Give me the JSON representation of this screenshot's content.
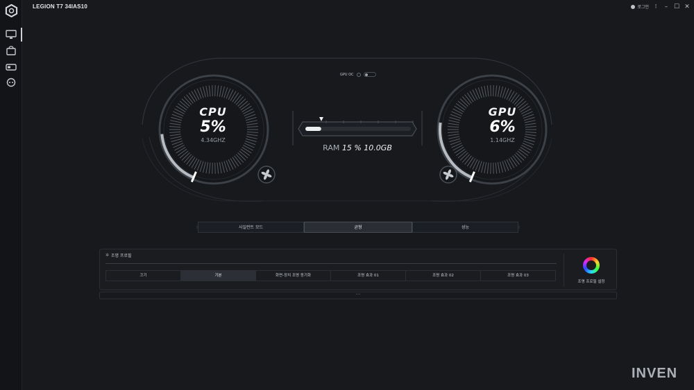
{
  "app": {
    "title": "LEGION T7 34IAS10"
  },
  "titlebar": {
    "login_label": "로그인"
  },
  "sidebar": {
    "items": [
      {
        "icon": "monitor-icon",
        "active": true
      },
      {
        "icon": "shop-bag-icon",
        "active": false
      },
      {
        "icon": "device-toggle-icon",
        "active": false
      },
      {
        "icon": "gamepad-icon",
        "active": false
      }
    ]
  },
  "gpu_oc": {
    "label": "GPU OC",
    "enabled": false
  },
  "cpu": {
    "name": "CPU",
    "percent": "5%",
    "clock": "4.34GHZ",
    "value": 5
  },
  "gpu": {
    "name": "GPU",
    "percent": "6%",
    "clock": "1.14GHZ",
    "value": 6
  },
  "ram": {
    "label": "RAM",
    "percent": "15 %",
    "used": "10.0GB",
    "fraction": 0.15
  },
  "modes": {
    "items": [
      "사일런트 모드",
      "균형",
      "성능"
    ],
    "selected": "균형"
  },
  "lighting": {
    "title": "조명 프로필",
    "effects": [
      "끄기",
      "기본",
      "화면-장치 조명 동기화",
      "조명 효과 01",
      "조명 효과 02",
      "조명 효과 03"
    ],
    "selected": "기본",
    "settings_label": "조명 프로필 설정"
  },
  "expand": {
    "label": "···"
  },
  "watermark": {
    "text": "INVEN"
  }
}
